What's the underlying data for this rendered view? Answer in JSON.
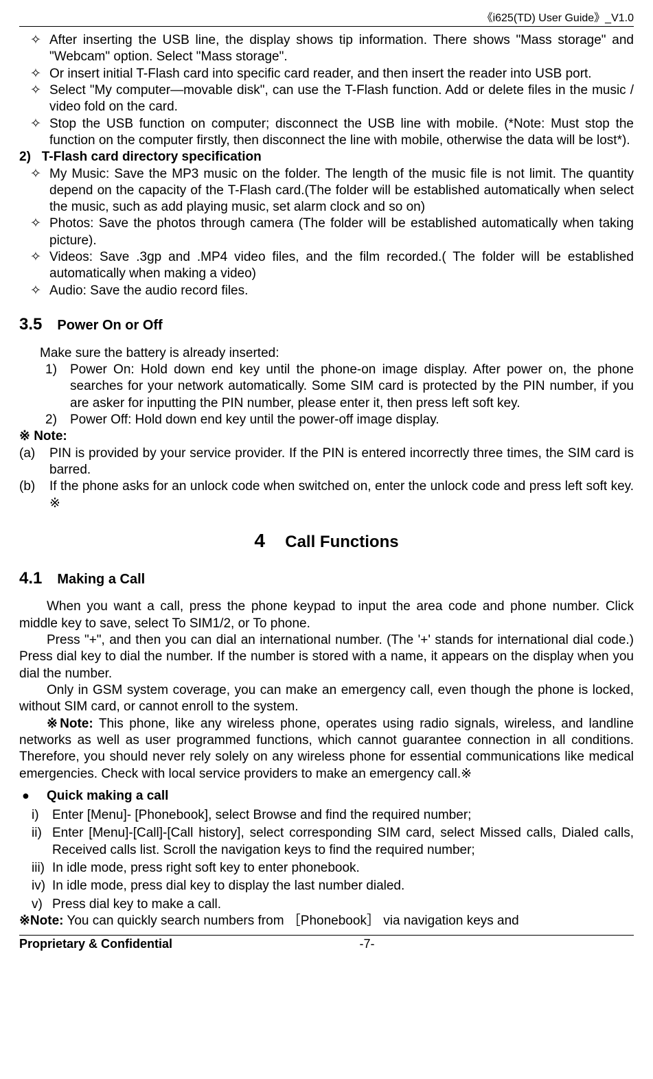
{
  "header": {
    "right": "《i625(TD)  User Guide》_V1.0"
  },
  "top_items": [
    "After inserting the USB line, the display shows tip information. There shows \"Mass storage\" and \"Webcam\" option. Select \"Mass storage\".",
    "Or insert initial T-Flash card into specific card reader, and then insert the reader into USB port.",
    "Select \"My computer—movable disk\", can use the T-Flash function. Add or delete files in the music / video fold on the card.",
    "Stop the USB function on computer; disconnect the USB line with mobile. (*Note: Must stop the function on the computer firstly, then disconnect the line with mobile, otherwise the data will be lost*)."
  ],
  "numhead2": {
    "num": "2)",
    "title": "T-Flash card directory specification"
  },
  "tf_items": [
    "My Music: Save the MP3 music on the folder. The length of the music file is not limit. The quantity depend on the capacity of the T-Flash card.(The folder will be established automatically when select the music, such as add playing music, set alarm clock and so on)",
    "Photos: Save the photos through camera (The folder will be established automatically when taking picture).",
    "Videos: Save .3gp and .MP4 video files, and the film recorded.( The folder will be established automatically when making a video)",
    "Audio: Save the audio record files."
  ],
  "sec35": {
    "num": "3.5",
    "title": "Power On or Off"
  },
  "sec35_intro": "Make sure the battery is already inserted:",
  "sec35_list": [
    {
      "k": "1)",
      "t": "Power On: Hold down end key until the phone-on image display. After power on, the phone searches for your network automatically. Some SIM card is protected by the PIN number, if you are asker for inputting the PIN number, please enter it, then press left soft key."
    },
    {
      "k": "2)",
      "t": "Power Off: Hold down end key until the power-off image display."
    }
  ],
  "note_label": "※ Note:",
  "note_ab": [
    {
      "k": "(a)",
      "t": "PIN is provided by your service provider. If the PIN is entered incorrectly three times, the SIM card is barred."
    },
    {
      "k": "(b)",
      "t": "If the phone asks for an unlock code when switched on, enter the unlock code and press left soft key.  ※"
    }
  ],
  "chapter4": {
    "num": "4",
    "title": "Call Functions"
  },
  "sec41": {
    "num": "4.1",
    "title": "Making a Call"
  },
  "sec41_paras": [
    "When you want a call, press the phone keypad to input the area code and phone number. Click middle key to save, select To SIM1/2, or To phone.",
    "Press \"+\", and then you can dial an international number. (The '+' stands for international dial code.) Press dial key to dial the number. If the number is stored with a name, it appears on the display when you dial the number.",
    "Only in GSM system coverage, you can make an emergency call, even though the phone is locked, without SIM card, or cannot enroll to the system."
  ],
  "sec41_note_prefix": "※Note:",
  "sec41_note_body": " This phone, like any wireless phone, operates using radio signals, wireless, and landline networks as well as user programmed functions, which cannot guarantee connection in all conditions. Therefore, you should never rely solely on any wireless phone for essential communications like medical emergencies. Check with local service providers to make an emergency call.※",
  "quick_label": "Quick making a call",
  "quick_list": [
    {
      "k": "i)",
      "t": "Enter [Menu]- [Phonebook], select Browse and find the required number;"
    },
    {
      "k": "ii)",
      "t": "Enter [Menu]-[Call]-[Call history], select corresponding SIM card, select Missed calls, Dialed calls, Received calls list. Scroll the navigation keys to find the required number;"
    },
    {
      "k": "iii)",
      "t": "In idle mode, press right soft key to enter phonebook."
    },
    {
      "k": "iv)",
      "t": "In idle mode, press dial key to display the last number dialed."
    },
    {
      "k": "v)",
      "t": "Press dial key to make a call."
    }
  ],
  "bottom_note_prefix": "※Note:",
  "bottom_note_body": " You can quickly search numbers from ［Phonebook］ via navigation keys and",
  "footer": {
    "left": "Proprietary & Confidential",
    "center": "-7-"
  },
  "glyphs": {
    "diamond": "✧",
    "bullet": "●"
  }
}
